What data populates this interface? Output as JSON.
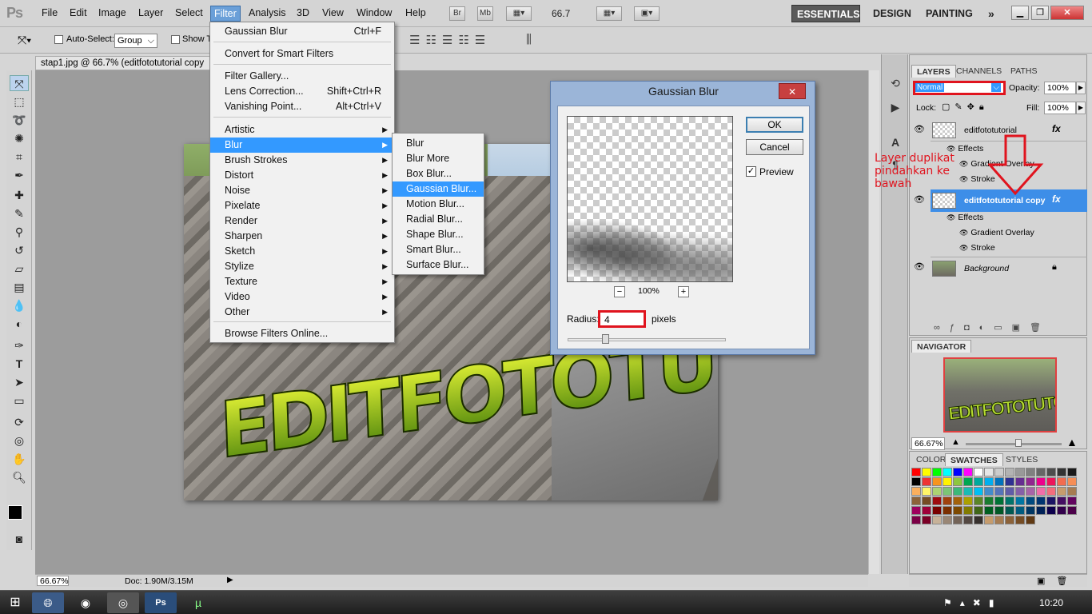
{
  "app": {
    "logo": "Ps"
  },
  "menubar": {
    "items": [
      "File",
      "Edit",
      "Image",
      "Layer",
      "Select",
      "Filter",
      "Analysis",
      "3D",
      "View",
      "Window",
      "Help"
    ],
    "zoom": "66.7",
    "workspaces": [
      "ESSENTIALS",
      "DESIGN",
      "PAINTING"
    ],
    "br_label": "Br",
    "mb_label": "Mb"
  },
  "options": {
    "auto_select_label": "Auto-Select:",
    "auto_select_value": "Group",
    "show_label": "Show T"
  },
  "document": {
    "tab_title": "stap1.jpg @ 66.7% (editfototutorial copy",
    "zoom_status": "66.67%",
    "doc_info": "Doc: 1.90M/3.15M",
    "photo_text": "EDITFOTOTUTORIAL"
  },
  "filter_menu": {
    "top_items": [
      {
        "label": "Gaussian Blur",
        "shortcut": "Ctrl+F"
      },
      {
        "label": "Convert for Smart Filters",
        "shortcut": ""
      },
      {
        "label": "Filter Gallery...",
        "shortcut": ""
      },
      {
        "label": "Lens Correction...",
        "shortcut": "Shift+Ctrl+R"
      },
      {
        "label": "Vanishing Point...",
        "shortcut": "Alt+Ctrl+V"
      }
    ],
    "sub_items": [
      "Artistic",
      "Blur",
      "Brush Strokes",
      "Distort",
      "Noise",
      "Pixelate",
      "Render",
      "Sharpen",
      "Sketch",
      "Stylize",
      "Texture",
      "Video",
      "Other"
    ],
    "browse": "Browse Filters Online...",
    "highlighted": "Blur"
  },
  "blur_submenu": {
    "items": [
      "Blur",
      "Blur More",
      "Box Blur...",
      "Gaussian Blur...",
      "Motion Blur...",
      "Radial Blur...",
      "Shape Blur...",
      "Smart Blur...",
      "Surface Blur..."
    ],
    "highlighted": "Gaussian Blur..."
  },
  "gaussian_dialog": {
    "title": "Gaussian Blur",
    "ok": "OK",
    "cancel": "Cancel",
    "preview_label": "Preview",
    "preview_checked": true,
    "zoom": "100%",
    "zoom_minus": "−",
    "zoom_plus": "+",
    "radius_label": "Radius:",
    "radius_value": "4",
    "radius_unit": "pixels",
    "close": "✕"
  },
  "layers_panel": {
    "tabs": [
      "LAYERS",
      "CHANNELS",
      "PATHS"
    ],
    "blend_mode": "Normal",
    "opacity_label": "Opacity:",
    "opacity_value": "100%",
    "lock_label": "Lock:",
    "fill_label": "Fill:",
    "fill_value": "100%",
    "layers": [
      {
        "name": "editfototutorial",
        "effects_label": "Effects",
        "effects": [
          "Gradient Overlay",
          "Stroke"
        ],
        "fx": "fx"
      },
      {
        "name": "editfototutorial copy",
        "effects_label": "Effects",
        "effects": [
          "Gradient Overlay",
          "Stroke"
        ],
        "fx": "fx"
      },
      {
        "name": "Background"
      }
    ],
    "annotation": "Layer duplikat pindahkan ke bawah"
  },
  "navigator": {
    "title": "NAVIGATOR",
    "zoom": "66.67%",
    "thumb_text": "EDITFOTOTUTORIAL"
  },
  "swatches": {
    "tabs": [
      "COLOR",
      "SWATCHES",
      "STYLES"
    ],
    "colors": [
      "#ff0000",
      "#ffff00",
      "#00ff00",
      "#00ffff",
      "#0000ff",
      "#ff00ff",
      "#ffffff",
      "#e6e6e6",
      "#cccccc",
      "#b3b3b3",
      "#999999",
      "#808080",
      "#666666",
      "#4d4d4d",
      "#333333",
      "#1a1a1a",
      "#000000",
      "#ee3333",
      "#f7941d",
      "#fff200",
      "#8dc63f",
      "#00a651",
      "#00a99d",
      "#00aeef",
      "#0072bc",
      "#2e3192",
      "#662d91",
      "#92278f",
      "#ec008c",
      "#ed145b",
      "#f26c4f",
      "#f68e56",
      "#fbaf5d",
      "#fff568",
      "#acd372",
      "#7cc576",
      "#3bb878",
      "#1abbb4",
      "#00bff3",
      "#438ccb",
      "#5574b9",
      "#605ca8",
      "#8560a8",
      "#a864a8",
      "#f06eaa",
      "#f26d7d",
      "#c69c6d",
      "#a67c52",
      "#8c6239",
      "#754c24",
      "#9e0b0f",
      "#a0410d",
      "#a3620a",
      "#aba000",
      "#598527",
      "#197b30",
      "#007236",
      "#00746b",
      "#0076a3",
      "#004a80",
      "#003471",
      "#1b1464",
      "#440e62",
      "#630460",
      "#9e005d",
      "#9e0039",
      "#790000",
      "#7b2e00",
      "#7d4900",
      "#827b00",
      "#406618",
      "#005e20",
      "#005826",
      "#005952",
      "#005b7f",
      "#003663",
      "#002157",
      "#0d004c",
      "#32004b",
      "#4b0049",
      "#7b0046",
      "#7a0026",
      "#c7b299",
      "#998675",
      "#736357",
      "#534741",
      "#37302d",
      "#c69c6d",
      "#a67c52",
      "#8c6239",
      "#754c24",
      "#603913"
    ]
  },
  "taskbar": {
    "clock": "10:20"
  }
}
